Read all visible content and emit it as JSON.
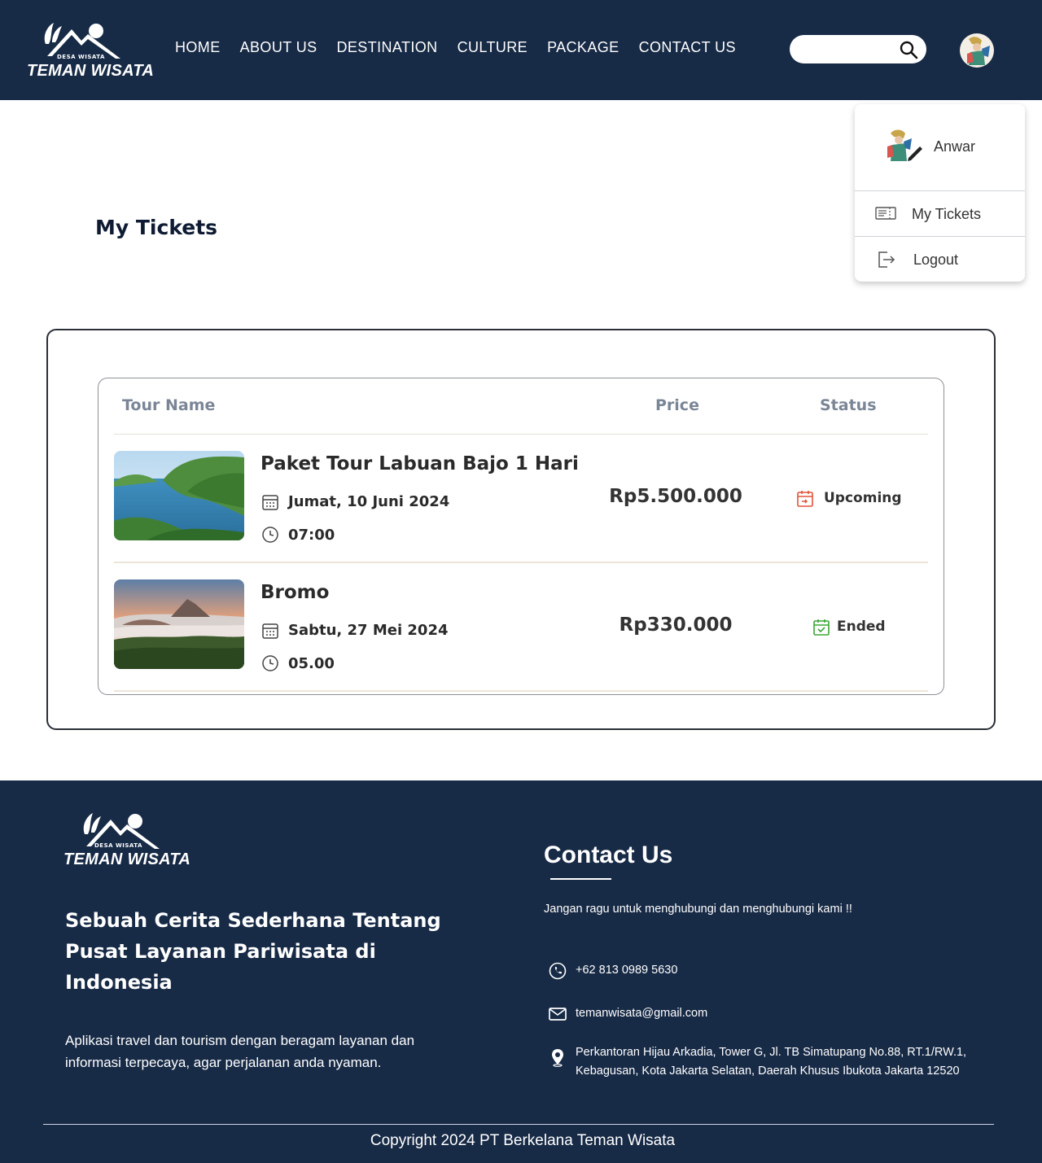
{
  "brand": {
    "small_text": "DESA WISATA",
    "name": "TEMAN WISATA"
  },
  "nav": {
    "links": [
      "HOME",
      "ABOUT US",
      "DESTINATION",
      "CULTURE",
      "PACKAGE",
      "CONTACT US"
    ],
    "search_placeholder": ""
  },
  "dropdown": {
    "user_name": "Anwar",
    "items": [
      {
        "label": "My Tickets",
        "icon": "ticket-icon"
      },
      {
        "label": "Logout",
        "icon": "logout-icon"
      }
    ]
  },
  "page": {
    "title": "My Tickets"
  },
  "table": {
    "headers": {
      "tour_name": "Tour Name",
      "price": "Price",
      "status": "Status"
    },
    "rows": [
      {
        "name": "Paket Tour Labuan Bajo 1 Hari",
        "date": "Jumat, 10 Juni 2024",
        "time": "07:00",
        "price": "Rp5.500.000",
        "status": "Upcoming",
        "status_color": "#e0533a"
      },
      {
        "name": "Bromo",
        "date": "Sabtu, 27 Mei 2024",
        "time": "05.00",
        "price": "Rp330.000",
        "status": "Ended",
        "status_color": "#3aa634"
      }
    ]
  },
  "footer": {
    "tagline": "Sebuah Cerita Sederhana Tentang Pusat Layanan Pariwisata di Indonesia",
    "description": "Aplikasi travel dan tourism dengan beragam layanan dan informasi terpecaya, agar perjalanan anda nyaman.",
    "contact_title": "Contact Us",
    "contact_desc": "Jangan ragu untuk menghubungi dan menghubungi kami !!",
    "phone": "+62 813 0989 5630",
    "email": "temanwisata@gmail.com",
    "address_line1": "Perkantoran Hijau Arkadia, Tower G, Jl. TB Simatupang No.88, RT.1/RW.1,",
    "address_line2": "Kebagusan, Kota Jakarta Selatan, Daerah Khusus Ibukota Jakarta 12520",
    "copyright": "Copyright 2024 PT Berkelana Teman Wisata"
  },
  "colors": {
    "navy": "#172a46",
    "upcoming": "#e0533a",
    "ended": "#3aa634"
  }
}
